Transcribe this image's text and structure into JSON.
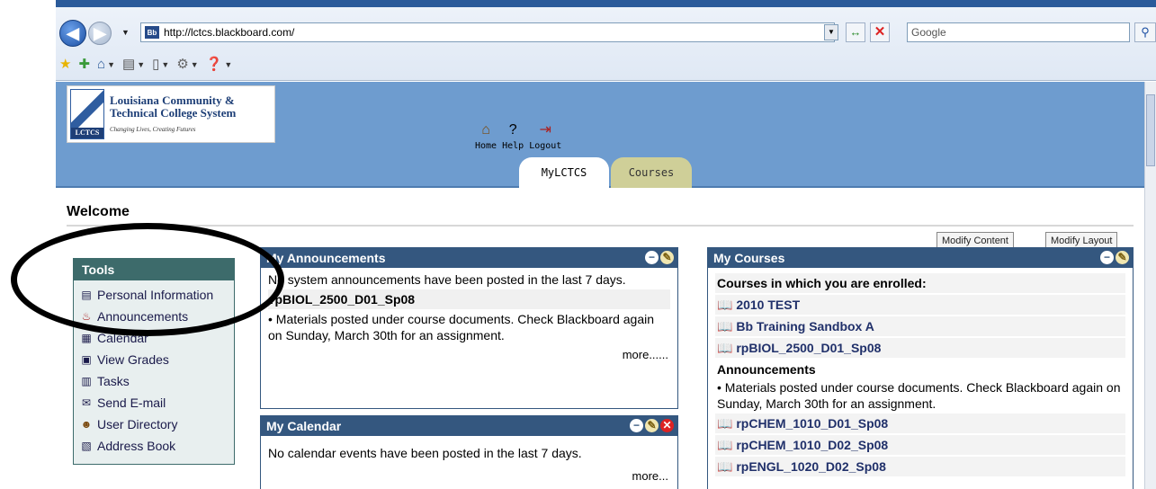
{
  "browser": {
    "url": "http://lctcs.blackboard.com/",
    "favicon_text": "Bb",
    "search_placeholder": "Google"
  },
  "site": {
    "logo": {
      "line1": "Louisiana Community &",
      "line2": "Technical College System",
      "tagline": "Changing Lives, Creating Futures",
      "abbrev": "LCTCS"
    },
    "top_links": [
      {
        "label": "Home",
        "icon": "home-icon"
      },
      {
        "label": "Help",
        "icon": "help-icon"
      },
      {
        "label": "Logout",
        "icon": "logout-icon"
      }
    ],
    "tabs": [
      {
        "label": "MyLCTCS",
        "active": true
      },
      {
        "label": "Courses",
        "active": false
      }
    ]
  },
  "page": {
    "welcome": "Welcome",
    "modify_content": "Modify Content",
    "modify_layout": "Modify Layout"
  },
  "tools": {
    "title": "Tools",
    "items": [
      {
        "label": "Personal Information",
        "icon": "id-card-icon"
      },
      {
        "label": "Announcements",
        "icon": "megaphone-icon"
      },
      {
        "label": "Calendar",
        "icon": "calendar-icon"
      },
      {
        "label": "View Grades",
        "icon": "grades-icon"
      },
      {
        "label": "Tasks",
        "icon": "tasks-icon"
      },
      {
        "label": "Send E-mail",
        "icon": "envelope-icon"
      },
      {
        "label": "User Directory",
        "icon": "user-icon"
      },
      {
        "label": "Address Book",
        "icon": "address-book-icon"
      }
    ]
  },
  "announcements": {
    "title": "My Announcements",
    "system_msg": "No system announcements have been posted in the last 7 days.",
    "course": "rpBIOL_2500_D01_Sp08",
    "item": "• Materials posted under course documents. Check Blackboard again on Sunday, March 30th for an assignment.",
    "more": "more......"
  },
  "calendar": {
    "title": "My Calendar",
    "msg": "No calendar events have been posted in the last 7 days.",
    "more": "more..."
  },
  "courses": {
    "title": "My Courses",
    "heading": "Courses in which you are enrolled:",
    "list1": [
      "2010 TEST",
      "Bb Training Sandbox A",
      "rpBIOL_2500_D01_Sp08"
    ],
    "ann_heading": "Announcements",
    "ann_item": "• Materials posted under course documents. Check Blackboard again on Sunday, March 30th for an assignment.",
    "list2": [
      "rpCHEM_1010_D01_Sp08",
      "rpCHEM_1010_D02_Sp08",
      "rpENGL_1020_D02_Sp08"
    ]
  }
}
